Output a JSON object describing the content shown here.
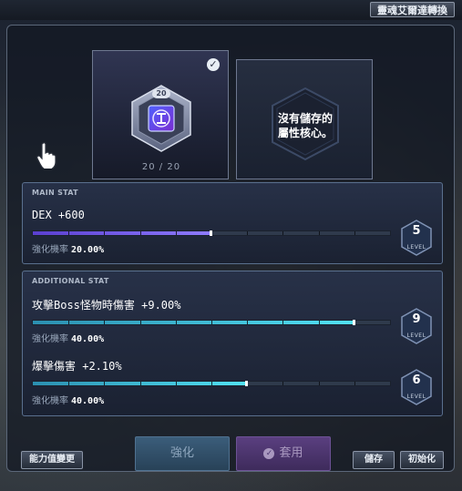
{
  "header": {
    "convert_button": "靈魂艾爾達轉換"
  },
  "core_slot": {
    "level_badge": "20",
    "count": "20 / 20",
    "selected": true
  },
  "stored_slot": {
    "empty_text_line1": "沒有儲存的",
    "empty_text_line2": "屬性核心。"
  },
  "main_stat": {
    "section_label": "MAIN STAT",
    "lines": [
      {
        "text": "DEX +600",
        "rate_label": "強化機率",
        "rate_value": "20.00%",
        "progress_fraction": 0.5,
        "level": "5",
        "level_caption": "LEVEL"
      }
    ]
  },
  "additional_stat": {
    "section_label": "ADDITIONAL STAT",
    "lines": [
      {
        "text": "攻擊Boss怪物時傷害 +9.00%",
        "rate_label": "強化機率",
        "rate_value": "40.00%",
        "progress_fraction": 0.9,
        "level": "9",
        "level_caption": "LEVEL"
      },
      {
        "text": "爆擊傷害 +2.10%",
        "rate_label": "強化機率",
        "rate_value": "40.00%",
        "progress_fraction": 0.6,
        "level": "6",
        "level_caption": "LEVEL"
      }
    ]
  },
  "footer": {
    "change_stat_button": "能力值變更",
    "enhance_button": "強化",
    "apply_button": "套用",
    "save_button": "儲存",
    "reset_button": "初始化"
  },
  "colors": {
    "main_bar": "#7a5cff",
    "additional_bar": "#4fd8f0",
    "enhance_button": "#3b5d7a",
    "apply_button": "#5a3f80"
  }
}
